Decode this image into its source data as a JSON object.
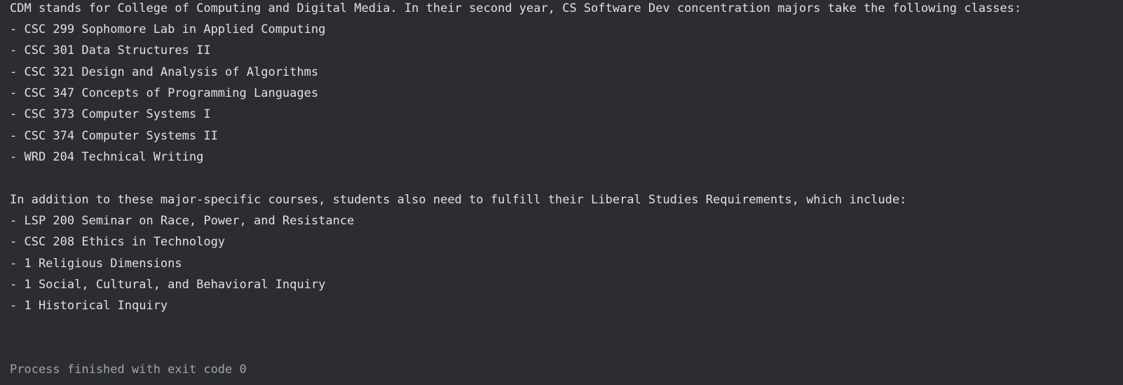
{
  "console": {
    "intro_line": "CDM stands for College of Computing and Digital Media. In their second year, CS Software Dev concentration majors take the following classes:",
    "courses": [
      "- CSC 299 Sophomore Lab in Applied Computing",
      "- CSC 301 Data Structures II",
      "- CSC 321 Design and Analysis of Algorithms",
      "- CSC 347 Concepts of Programming Languages",
      "- CSC 373 Computer Systems I",
      "- CSC 374 Computer Systems II",
      "- WRD 204 Technical Writing"
    ],
    "liberal_intro": "In addition to these major-specific courses, students also need to fulfill their Liberal Studies Requirements, which include:",
    "liberal_items": [
      "- LSP 200 Seminar on Race, Power, and Resistance",
      "- CSC 208 Ethics in Technology",
      "- 1 Religious Dimensions",
      "- 1 Social, Cultural, and Behavioral Inquiry",
      "- 1 Historical Inquiry"
    ],
    "process_status": "Process finished with exit code 0"
  },
  "colors": {
    "background": "#2b2d30",
    "text": "#dfe1e5",
    "muted_text": "#a0a4aa"
  }
}
